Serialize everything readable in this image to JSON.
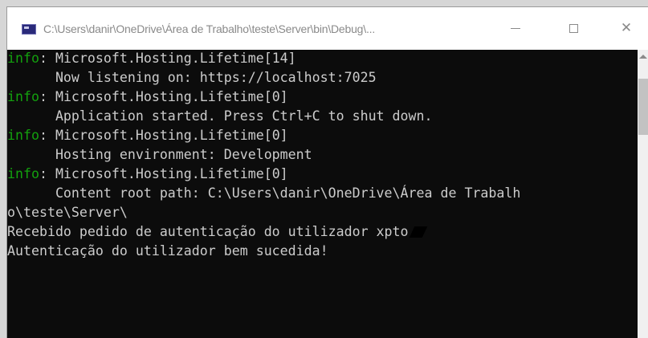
{
  "window": {
    "title": "C:\\Users\\danir\\OneDrive\\Área de Trabalho\\teste\\Server\\bin\\Debug\\...",
    "close_glyph": "✕"
  },
  "console": {
    "lines": [
      {
        "level": "info",
        "sep": ": ",
        "text": "Microsoft.Hosting.Lifetime[14]"
      },
      {
        "level": "",
        "sep": "",
        "text": "      Now listening on: https://localhost:7025"
      },
      {
        "level": "info",
        "sep": ": ",
        "text": "Microsoft.Hosting.Lifetime[0]"
      },
      {
        "level": "",
        "sep": "",
        "text": "      Application started. Press Ctrl+C to shut down."
      },
      {
        "level": "info",
        "sep": ": ",
        "text": "Microsoft.Hosting.Lifetime[0]"
      },
      {
        "level": "",
        "sep": "",
        "text": "      Hosting environment: Development"
      },
      {
        "level": "info",
        "sep": ": ",
        "text": "Microsoft.Hosting.Lifetime[0]"
      },
      {
        "level": "",
        "sep": "",
        "text": "      Content root path: C:\\Users\\danir\\OneDrive\\Área de Trabalh"
      },
      {
        "level": "",
        "sep": "",
        "text": "o\\teste\\Server\\"
      },
      {
        "level": "",
        "sep": "",
        "text": "Recebido pedido de autenticação do utilizador xpto"
      },
      {
        "level": "",
        "sep": "",
        "text": "Autenticação do utilizador bem sucedida!"
      }
    ]
  },
  "colors": {
    "console_bg": "#0c0c0c",
    "console_text": "#cccccc",
    "info_green": "#13a10e",
    "titlebar_bg": "#ffffff"
  },
  "icons": {
    "app": "console-window-icon",
    "minimize": "minimize-icon",
    "maximize": "maximize-icon",
    "close": "close-icon"
  }
}
